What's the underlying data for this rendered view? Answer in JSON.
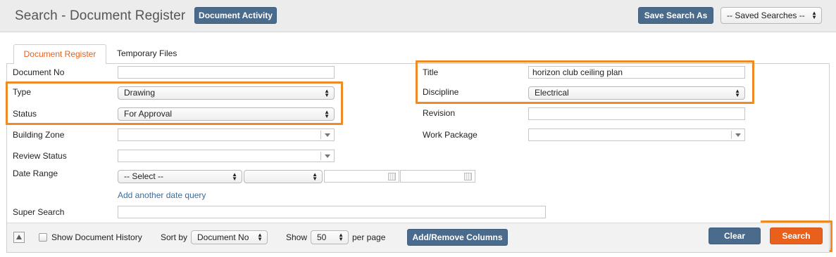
{
  "header": {
    "title": "Search - Document Register",
    "document_activity": "Document Activity",
    "save_search_as": "Save Search As",
    "saved_searches": "-- Saved Searches --"
  },
  "tabs": [
    {
      "label": "Document Register",
      "active": true
    },
    {
      "label": "Temporary Files",
      "active": false
    }
  ],
  "form": {
    "document_no": {
      "label": "Document No",
      "value": ""
    },
    "type": {
      "label": "Type",
      "value": "Drawing"
    },
    "status": {
      "label": "Status",
      "value": "For Approval"
    },
    "building_zone": {
      "label": "Building Zone",
      "value": ""
    },
    "review_status": {
      "label": "Review Status",
      "value": ""
    },
    "date_range": {
      "label": "Date Range",
      "select": "-- Select --",
      "operator": ""
    },
    "add_date_query": "Add another date query",
    "super_search": {
      "label": "Super Search",
      "value": ""
    },
    "title": {
      "label": "Title",
      "value": "horizon club ceiling plan"
    },
    "discipline": {
      "label": "Discipline",
      "value": "Electrical"
    },
    "revision": {
      "label": "Revision",
      "value": ""
    },
    "work_package": {
      "label": "Work Package",
      "value": ""
    }
  },
  "footer": {
    "show_history": "Show Document History",
    "show_history_checked": false,
    "sort_by_label": "Sort by",
    "sort_by_value": "Document No",
    "show_label": "Show",
    "show_value": "50",
    "per_page_label": "per page",
    "add_remove_columns": "Add/Remove Columns",
    "clear": "Clear",
    "search": "Search"
  },
  "colors": {
    "accent": "#e8601c",
    "button_blue": "#4a6b8c",
    "highlight": "#ef8a25",
    "link": "#3d6b9a"
  }
}
